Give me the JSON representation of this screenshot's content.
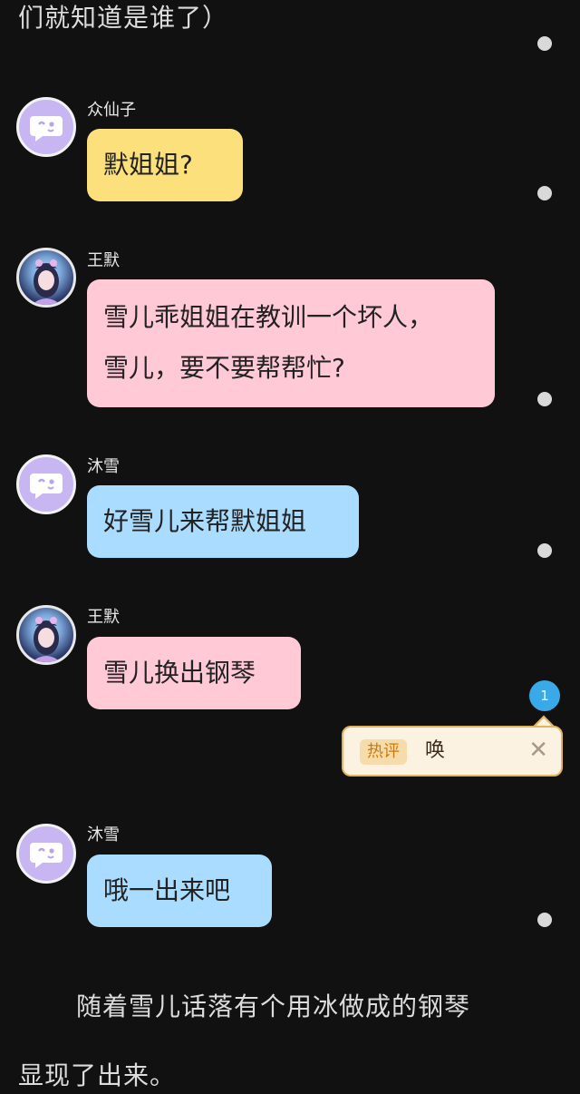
{
  "top_text": "们就知道是谁了）",
  "messages": [
    {
      "name": "众仙子",
      "text": "默姐姐?",
      "avatar": "chat-bot-icon"
    },
    {
      "name": "王默",
      "line1": "雪儿乖姐姐在教训一个坏人，",
      "line2": "雪儿，要不要帮帮忙?",
      "avatar": "character-portrait"
    },
    {
      "name": "沐雪",
      "text": "好雪儿来帮默姐姐",
      "avatar": "chat-bot-icon"
    },
    {
      "name": "王默",
      "text": "雪儿换出钢琴",
      "avatar": "character-portrait"
    },
    {
      "name": "沐雪",
      "text": "哦一出来吧",
      "avatar": "chat-bot-icon"
    }
  ],
  "hot_comment": {
    "count": "1",
    "tag": "热评",
    "text": "唤",
    "close": "✕"
  },
  "narration": {
    "line1": "随着雪儿话落有个用冰做成的钢琴",
    "line2": "显现了出来。"
  },
  "colors": {
    "background": "#111111",
    "yellow_bubble": "#fbe07b",
    "pink_bubble": "#ffc9d6",
    "blue_bubble": "#a9dcff",
    "bot_avatar": "#c8b6f2",
    "badge": "#3aa9e8"
  }
}
